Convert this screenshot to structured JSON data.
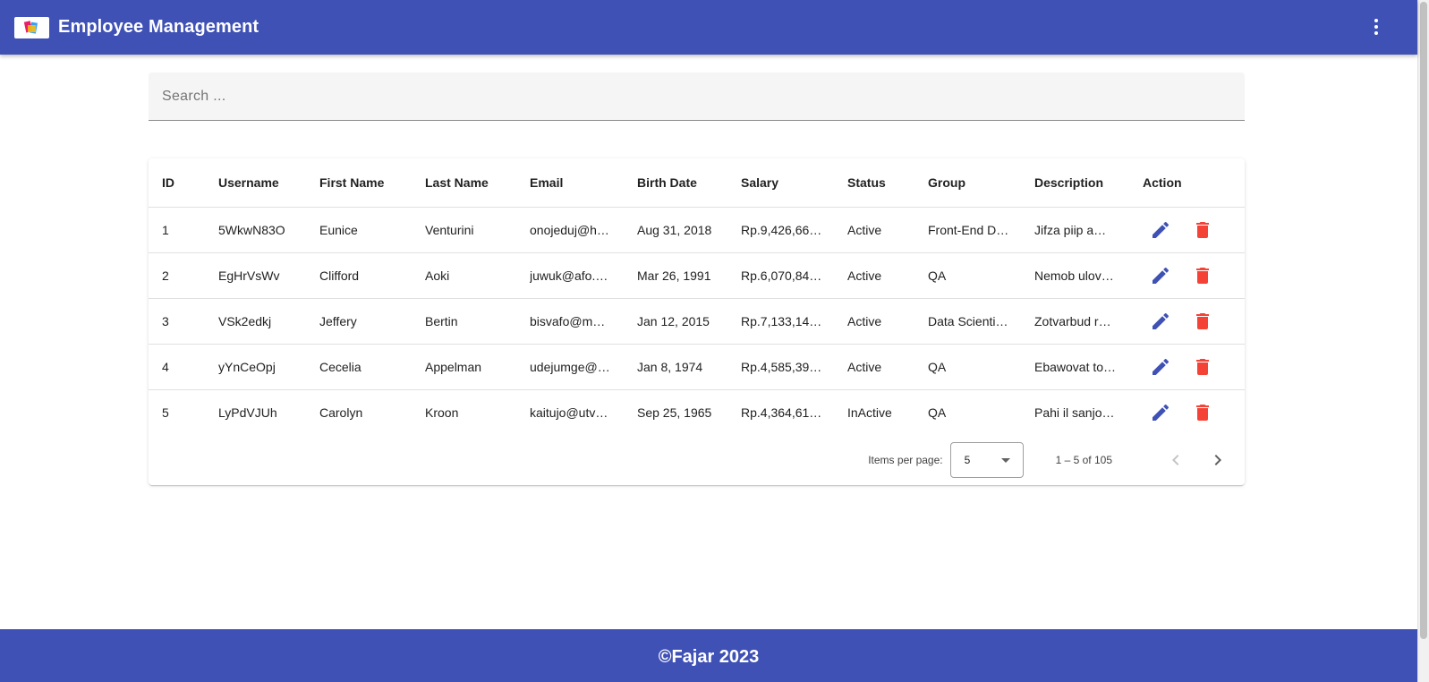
{
  "header": {
    "title": "Employee Management",
    "logo_icon": "app-logo-icon",
    "menu_icon": "more-vert-icon",
    "background_color": "#3f51b5"
  },
  "search": {
    "placeholder": "Search ...",
    "value": ""
  },
  "table": {
    "columns": [
      "ID",
      "Username",
      "First Name",
      "Last Name",
      "Email",
      "Birth Date",
      "Salary",
      "Status",
      "Group",
      "Description",
      "Action"
    ],
    "rows": [
      {
        "id": "1",
        "username": "5WkwN83O",
        "first_name": "Eunice",
        "last_name": "Venturini",
        "email": "onojeduj@h…",
        "birth_date": "Aug 31, 2018",
        "salary": "Rp.9,426,66…",
        "status": "Active",
        "group": "Front-End D…",
        "description": "Jifza piip a…"
      },
      {
        "id": "2",
        "username": "EgHrVsWv",
        "first_name": "Clifford",
        "last_name": "Aoki",
        "email": "juwuk@afo.…",
        "birth_date": "Mar 26, 1991",
        "salary": "Rp.6,070,84…",
        "status": "Active",
        "group": "QA",
        "description": "Nemob ulov…"
      },
      {
        "id": "3",
        "username": "VSk2edkj",
        "first_name": "Jeffery",
        "last_name": "Bertin",
        "email": "bisvafo@m…",
        "birth_date": "Jan 12, 2015",
        "salary": "Rp.7,133,14…",
        "status": "Active",
        "group": "Data Scienti…",
        "description": "Zotvarbud r…"
      },
      {
        "id": "4",
        "username": "yYnCeOpj",
        "first_name": "Cecelia",
        "last_name": "Appelman",
        "email": "udejumge@…",
        "birth_date": "Jan 8, 1974",
        "salary": "Rp.4,585,39…",
        "status": "Active",
        "group": "QA",
        "description": "Ebawovat to…"
      },
      {
        "id": "5",
        "username": "LyPdVJUh",
        "first_name": "Carolyn",
        "last_name": "Kroon",
        "email": "kaitujo@utv…",
        "birth_date": "Sep 25, 1965",
        "salary": "Rp.4,364,61…",
        "status": "InActive",
        "group": "QA",
        "description": "Pahi il sanjo…"
      }
    ],
    "edit_icon": "pencil-icon",
    "delete_icon": "trash-icon",
    "edit_color": "#3f51b5",
    "delete_color": "#f44336"
  },
  "paginator": {
    "items_per_page_label": "Items per page:",
    "items_per_page_value": "5",
    "range_label": "1 – 5 of 105",
    "prev_icon": "chevron-left-icon",
    "next_icon": "chevron-right-icon"
  },
  "footer": {
    "text": "©Fajar 2023"
  }
}
